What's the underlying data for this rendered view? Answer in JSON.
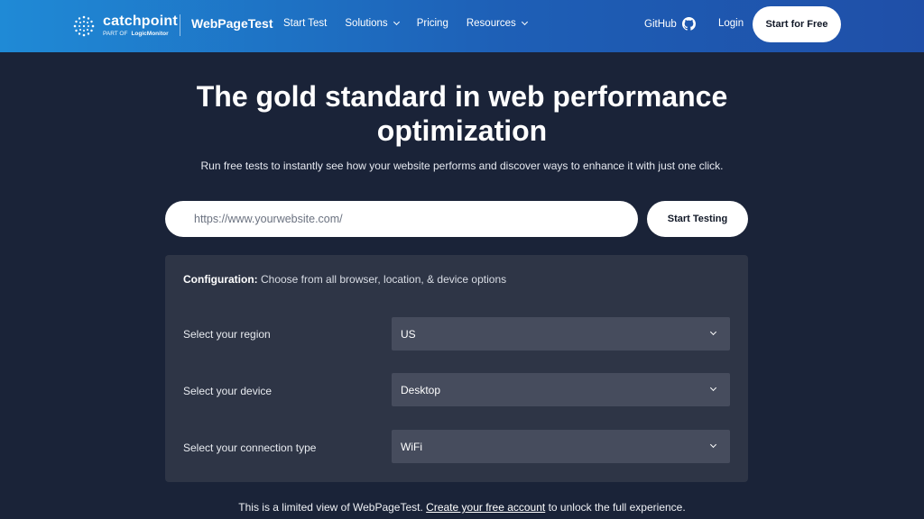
{
  "header": {
    "brand_name": "catchpoint",
    "brand_sub_prefix": "PART OF",
    "brand_sub_company": "LogicMonitor",
    "product_name": "WebPageTest",
    "nav": [
      {
        "label": "Start Test",
        "has_dropdown": false
      },
      {
        "label": "Solutions",
        "has_dropdown": true
      },
      {
        "label": "Pricing",
        "has_dropdown": false
      },
      {
        "label": "Resources",
        "has_dropdown": true
      }
    ],
    "github_label": "GitHub",
    "login_label": "Login",
    "cta_label": "Start for Free"
  },
  "hero": {
    "headline": "The gold standard in web performance optimization",
    "subhead": "Run free tests to instantly see how your website performs and discover ways to enhance it with just one click.",
    "url_placeholder": "https://www.yourwebsite.com/",
    "start_button": "Start Testing"
  },
  "config": {
    "title_bold": "Configuration:",
    "title_rest": " Choose from all browser, location, & device options",
    "rows": [
      {
        "label": "Select your region",
        "value": "US"
      },
      {
        "label": "Select your device",
        "value": "Desktop"
      },
      {
        "label": "Select your connection type",
        "value": "WiFi"
      }
    ]
  },
  "footer_note": {
    "before": "This is a limited view of WebPageTest. ",
    "link": "Create your free account",
    "after": " to unlock the full experience."
  },
  "colors": {
    "page_bg": "#1a2338",
    "header_gradient_start": "#1f8ad6",
    "header_gradient_end": "#1f4fa8",
    "panel_bg": "#2e3546",
    "select_bg": "#464c5d"
  },
  "icons": [
    "catchpoint-logo-icon",
    "chevron-down-icon",
    "github-icon"
  ]
}
